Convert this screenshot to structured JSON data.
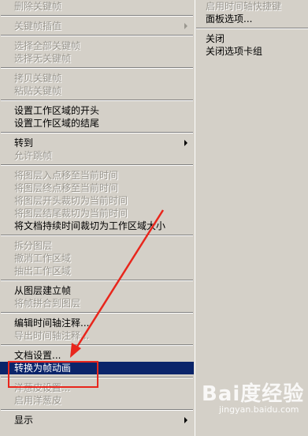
{
  "left_menu": {
    "items": [
      {
        "label": "删除关键帧",
        "disabled": true
      },
      {
        "sep": true
      },
      {
        "label": "关键帧插值",
        "disabled": true,
        "submenu": true
      },
      {
        "sep": true
      },
      {
        "label": "选择全部关键帧",
        "disabled": true
      },
      {
        "label": "选择无关键帧",
        "disabled": true
      },
      {
        "sep": true
      },
      {
        "label": "拷贝关键帧",
        "disabled": true
      },
      {
        "label": "粘贴关键帧",
        "disabled": true
      },
      {
        "sep": true
      },
      {
        "label": "设置工作区域的开头",
        "disabled": false
      },
      {
        "label": "设置工作区域的结尾",
        "disabled": false
      },
      {
        "sep": true
      },
      {
        "label": "转到",
        "disabled": false,
        "submenu": true
      },
      {
        "label": "允许跳帧",
        "disabled": true
      },
      {
        "sep": true
      },
      {
        "label": "将图层入点移至当前时间",
        "disabled": true
      },
      {
        "label": "将图层终点移至当前时间",
        "disabled": true
      },
      {
        "label": "将图层开头裁切为当前时间",
        "disabled": true
      },
      {
        "label": "将图层结尾裁切为当前时间",
        "disabled": true
      },
      {
        "label": "将文档持续时间裁切为工作区域大小",
        "disabled": false
      },
      {
        "sep": true
      },
      {
        "label": "拆分图层",
        "disabled": true
      },
      {
        "label": "撤消工作区域",
        "disabled": true
      },
      {
        "label": "抽出工作区域",
        "disabled": true
      },
      {
        "sep": true
      },
      {
        "label": "从图层建立帧",
        "disabled": false
      },
      {
        "label": "将帧拼合到图层",
        "disabled": true
      },
      {
        "sep": true
      },
      {
        "label": "编辑时间轴注释...",
        "disabled": false
      },
      {
        "label": "导出时间轴注释...",
        "disabled": true
      },
      {
        "sep": true
      },
      {
        "label": "文档设置...",
        "disabled": false
      },
      {
        "label": "转换为帧动画",
        "disabled": false,
        "selected": true
      },
      {
        "sep": true
      },
      {
        "label": "洋葱皮设置...",
        "disabled": true
      },
      {
        "label": "启用洋葱皮",
        "disabled": true
      },
      {
        "sep": true
      },
      {
        "label": "显示",
        "disabled": false,
        "submenu": true
      }
    ]
  },
  "right_menu": {
    "items": [
      {
        "label": "启用时间轴快捷键",
        "disabled": true
      },
      {
        "label": "面板选项...",
        "disabled": false
      },
      {
        "sep": true
      },
      {
        "label": "关闭",
        "disabled": false
      },
      {
        "label": "关闭选项卡组",
        "disabled": false
      }
    ]
  },
  "watermark": {
    "text": "Bai度经验",
    "sub": "jingyan.baidu.com"
  },
  "colors": {
    "menu_bg": "#d4d0c8",
    "selected_bg": "#0a246a",
    "annotation_red": "#e8261c",
    "disabled_text": "#9a978f"
  }
}
